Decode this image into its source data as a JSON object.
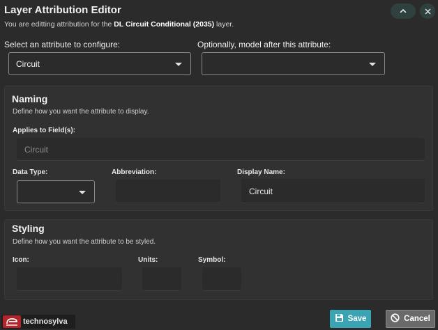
{
  "header": {
    "title": "Layer Attribution Editor",
    "subtitle_prefix": "You are editting attribution for the ",
    "layer_name": "DL Circuit Conditional (2035)",
    "subtitle_suffix": " layer.",
    "collapse_icon": "chevron-up-icon",
    "close_icon": "close-icon"
  },
  "selectors": {
    "attribute_label": "Select an attribute to configure:",
    "attribute_value": "Circuit",
    "model_label": "Optionally, model after this attribute:",
    "model_value": ""
  },
  "naming": {
    "title": "Naming",
    "description": "Define how you want the attribute to display.",
    "applies_label": "Applies to Field(s):",
    "applies_value": "Circuit",
    "data_type_label": "Data Type:",
    "data_type_value": "",
    "abbreviation_label": "Abbreviation:",
    "abbreviation_value": "",
    "display_name_label": "Display Name:",
    "display_name_value": "Circuit"
  },
  "styling": {
    "title": "Styling",
    "description": "Define how you want the attribute to be styled.",
    "icon_label": "Icon:",
    "icon_value": "",
    "units_label": "Units:",
    "units_value": "",
    "symbol_label": "Symbol:",
    "symbol_value": ""
  },
  "footer": {
    "logo_text": "technosylva",
    "save_label": "Save",
    "save_icon": "save-icon",
    "cancel_label": "Cancel",
    "cancel_icon": "cancel-icon"
  },
  "colors": {
    "background": "#2b2b2b",
    "panel": "#313131",
    "accent": "#3aa3b4",
    "logo_red": "#b3252b"
  }
}
